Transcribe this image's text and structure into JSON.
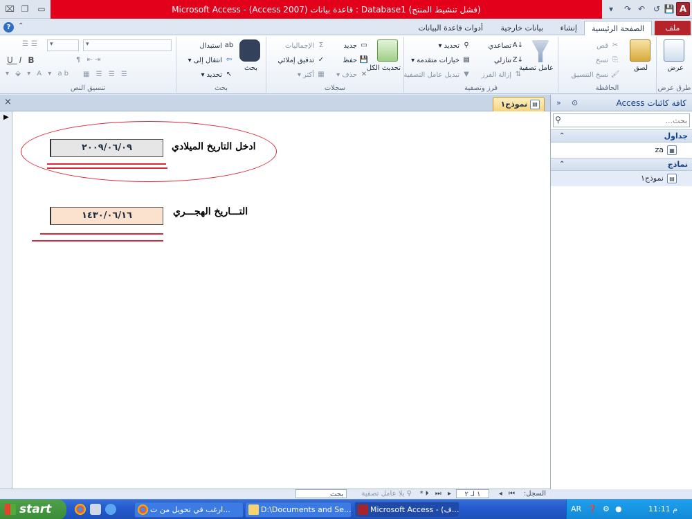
{
  "window": {
    "title": "Microsoft Access - (Access 2007) قاعدة بيانات : Database1 (فشل تنشيط المنتج)",
    "app_letter": "A"
  },
  "ribbon_tabs": [
    {
      "label": "ملف"
    },
    {
      "label": "الصفحة الرئيسية"
    },
    {
      "label": "إنشاء"
    },
    {
      "label": "بيانات خارجية"
    },
    {
      "label": "أدوات قاعدة البيانات"
    }
  ],
  "ribbon": {
    "views": {
      "view": "عرض",
      "group": "طرق عرض"
    },
    "clipboard": {
      "paste": "لصق",
      "cut": "قص",
      "copy": "نسخ",
      "format_painter": "نسخ التنسيق",
      "group": "الحافظة"
    },
    "sort_filter": {
      "filter": "عامل تصفية",
      "ascending": "تصاعدي",
      "descending": "تنازلي",
      "remove_sort": "إزالة الفرز",
      "selection": "تحديد",
      "advanced": "خيارات متقدمة",
      "toggle_filter": "تبديل عامل التصفية",
      "group": "فرز وتصفية"
    },
    "records": {
      "refresh": "تحديث الكل",
      "new": "جديد",
      "save": "حفظ",
      "delete": "حذف",
      "totals": "الإجماليات",
      "spelling": "تدقيق إملائي",
      "more": "أكثر",
      "group": "سجلات"
    },
    "find": {
      "find": "بحث",
      "replace": "استبدال",
      "goto": "انتقال إلى",
      "select": "تحديد",
      "group": "بحث"
    },
    "text_format": {
      "group": "تنسيق النص"
    }
  },
  "nav_pane": {
    "title": "كافة كائنات Access",
    "search_placeholder": "بحث...",
    "sections": [
      {
        "label": "جداول",
        "items": [
          "za"
        ]
      },
      {
        "label": "نماذج",
        "items": [
          "نموذج١"
        ]
      }
    ]
  },
  "document": {
    "tab_label": "نموذج١",
    "gregorian_label": "ادخل التاريخ الميلادي",
    "gregorian_value": "٢٠٠٩/٠٦/٠٩",
    "hijri_label": "التـــاريخ الهجـــري",
    "hijri_value": "١٤٣٠/٠٦/١٦"
  },
  "record_bar": {
    "record_label": "السجل:",
    "record_value": "١ لـ ٢",
    "no_filter": "بلا عامل تصفية",
    "search": "بحث"
  },
  "taskbar": {
    "start": "start",
    "buttons": [
      "ارغب في تحويل من ت...",
      "D:\\Documents and Se...",
      "Microsoft Access - (ف..."
    ],
    "lang": "AR",
    "clock": "11:11 م"
  }
}
